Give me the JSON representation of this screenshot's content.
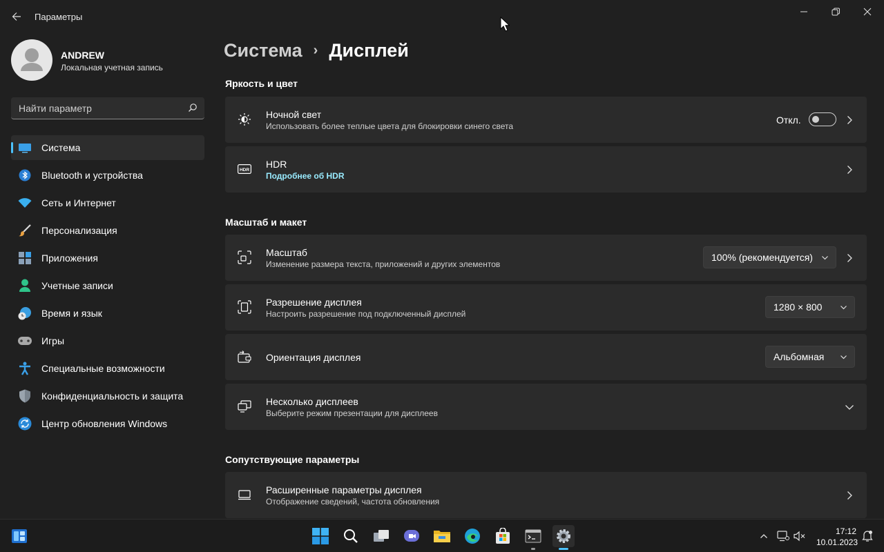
{
  "window": {
    "title": "Параметры"
  },
  "profile": {
    "name": "ANDREW",
    "subtitle": "Локальная учетная запись"
  },
  "search": {
    "placeholder": "Найти параметр"
  },
  "sidebar": {
    "items": [
      {
        "label": "Система",
        "icon": "system-icon",
        "active": true
      },
      {
        "label": "Bluetooth и устройства",
        "icon": "bluetooth-icon"
      },
      {
        "label": "Сеть и Интернет",
        "icon": "wifi-icon"
      },
      {
        "label": "Персонализация",
        "icon": "brush-icon"
      },
      {
        "label": "Приложения",
        "icon": "apps-icon"
      },
      {
        "label": "Учетные записи",
        "icon": "person-icon"
      },
      {
        "label": "Время и язык",
        "icon": "globe-clock-icon"
      },
      {
        "label": "Игры",
        "icon": "gamepad-icon"
      },
      {
        "label": "Специальные возможности",
        "icon": "accessibility-icon"
      },
      {
        "label": "Конфиденциальность и защита",
        "icon": "shield-icon"
      },
      {
        "label": "Центр обновления Windows",
        "icon": "update-icon"
      }
    ]
  },
  "breadcrumb": {
    "parent": "Система",
    "separator": "›",
    "current": "Дисплей"
  },
  "sections": {
    "brightness": "Яркость и цвет",
    "scale_layout": "Масштаб и макет",
    "related": "Сопутствующие параметры"
  },
  "night_light": {
    "title": "Ночной свет",
    "subtitle": "Использовать более теплые цвета для блокировки синего света",
    "state": "Откл."
  },
  "hdr": {
    "title": "HDR",
    "link": "Подробнее об HDR"
  },
  "scale": {
    "title": "Масштаб",
    "subtitle": "Изменение размера текста, приложений и других элементов",
    "value": "100% (рекомендуется)"
  },
  "resolution": {
    "title": "Разрешение дисплея",
    "subtitle": "Настроить разрешение под подключенный дисплей",
    "value": "1280 × 800"
  },
  "orientation": {
    "title": "Ориентация дисплея",
    "value": "Альбомная"
  },
  "multi_display": {
    "title": "Несколько дисплеев",
    "subtitle": "Выберите режим презентации для дисплеев"
  },
  "advanced_display": {
    "title": "Расширенные параметры дисплея",
    "subtitle": "Отображение сведений, частота обновления"
  },
  "taskbar": {
    "time": "17:12",
    "date": "10.01.2023",
    "apps": [
      "start-icon",
      "search-icon",
      "task-view-icon",
      "chat-icon",
      "file-explorer-icon",
      "edge-icon",
      "store-icon",
      "terminal-icon",
      "settings-icon"
    ]
  },
  "colors": {
    "accent": "#4cc2ff",
    "background": "#202020",
    "card": "#2b2b2b",
    "link": "#99ebff"
  }
}
